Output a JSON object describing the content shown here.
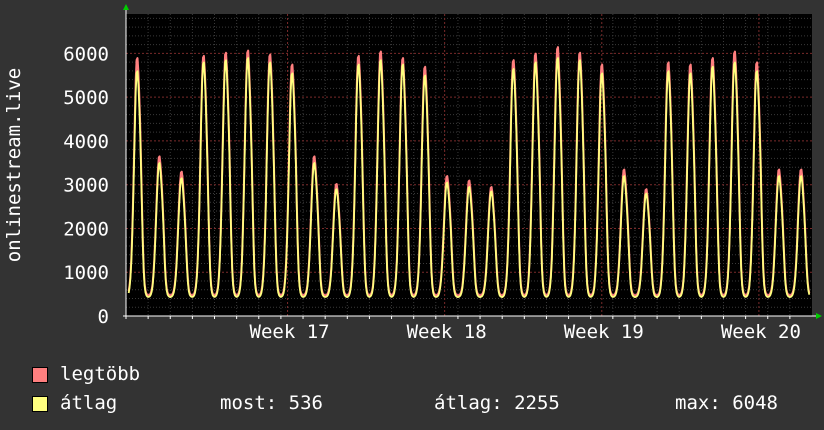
{
  "chart_data": {
    "type": "line",
    "title": "",
    "ylabel": "onlinestream.live",
    "ylim": [
      0,
      6900
    ],
    "yticks": [
      0,
      1000,
      2000,
      3000,
      4000,
      5000,
      6000
    ],
    "xticks": [
      {
        "label": "Week 17",
        "day": 7.3
      },
      {
        "label": "Week 18",
        "day": 14.4
      },
      {
        "label": "Week 19",
        "day": 21.5
      },
      {
        "label": "Week 20",
        "day": 28.6
      }
    ],
    "x_unit": "days",
    "xlim": [
      0,
      31
    ],
    "grid": true,
    "series": [
      {
        "name": "legtöbb",
        "color": "#ff7f7f",
        "daily_peaks": [
          5900,
          3650,
          3300,
          5950,
          6020,
          6070,
          5980,
          5750,
          3650,
          3020,
          5950,
          6050,
          5900,
          5700,
          3200,
          3100,
          2950,
          5850,
          6000,
          6150,
          6020,
          5750,
          3350,
          2900,
          5800,
          5750,
          5900,
          6048,
          5800,
          3350
        ],
        "daily_low": 470
      },
      {
        "name": "átlag",
        "color": "#ffff7f",
        "daily_peaks": [
          5600,
          3500,
          3150,
          5800,
          5850,
          5900,
          5800,
          5550,
          3500,
          2900,
          5750,
          5850,
          5750,
          5500,
          3050,
          2950,
          2850,
          5650,
          5800,
          5900,
          5850,
          5550,
          3200,
          2800,
          5600,
          5550,
          5700,
          5800,
          5600,
          3200
        ],
        "daily_low": 430
      }
    ]
  },
  "legend": {
    "max_label": "legtöbb",
    "avg_label": "átlag",
    "max_color": "#ff7f7f",
    "avg_color": "#ffff7f",
    "current": "most: 536",
    "average": "átlag: 2255",
    "maximum": "max: 6048"
  }
}
